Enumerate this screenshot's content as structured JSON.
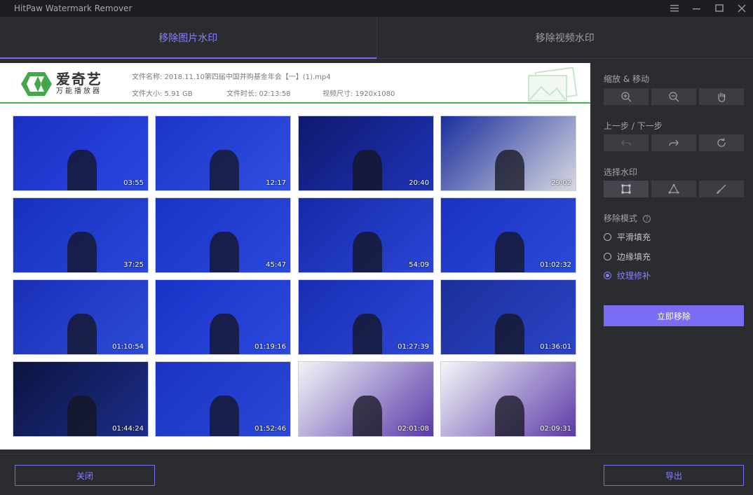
{
  "app": {
    "title": "HitPaw Watermark Remover"
  },
  "window_controls": [
    "menu-icon",
    "minimize-icon",
    "maximize-icon",
    "close-icon"
  ],
  "tabs": [
    {
      "label": "移除图片水印",
      "active": true
    },
    {
      "label": "移除视频水印",
      "active": false
    }
  ],
  "preview": {
    "logo": {
      "main": "爱奇艺",
      "sub": "万能播放器"
    },
    "file_name": "文件名称: 2018.11.10第四届中国并购基金年会【一】(1).mp4",
    "file_size": "文件大小: 5.91 GB",
    "duration": "文件时长: 02:13:58",
    "resolution": "视频尺寸: 1920x1080",
    "thumbnails": [
      {
        "time": "03:55"
      },
      {
        "time": "12:17"
      },
      {
        "time": "20:40"
      },
      {
        "time": "29:02"
      },
      {
        "time": "37:25"
      },
      {
        "time": "45:47"
      },
      {
        "time": "54:09"
      },
      {
        "time": "01:02:32"
      },
      {
        "time": "01:10:54"
      },
      {
        "time": "01:19:16"
      },
      {
        "time": "01:27:39"
      },
      {
        "time": "01:36:01"
      },
      {
        "time": "01:44:24"
      },
      {
        "time": "01:52:46"
      },
      {
        "time": "02:01:08"
      },
      {
        "time": "02:09:31"
      }
    ]
  },
  "sidebar": {
    "zoom_label": "缩放 & 移动",
    "zoom_tools": [
      "zoom-in-icon",
      "zoom-out-icon",
      "hand-icon"
    ],
    "history_label": "上一步 / 下一步",
    "history_tools": [
      "undo-icon",
      "redo-icon",
      "reset-icon"
    ],
    "select_label": "选择水印",
    "select_tools": [
      "rectangle-select-icon",
      "polygon-select-icon",
      "brush-icon"
    ],
    "mode_label": "移除模式",
    "modes": [
      {
        "label": "平滑填充",
        "selected": false
      },
      {
        "label": "边缘填充",
        "selected": false
      },
      {
        "label": "纹理修补",
        "selected": true
      }
    ],
    "remove_button": "立即移除"
  },
  "footer": {
    "close_button": "关闭",
    "export_button": "导出"
  },
  "colors": {
    "accent": "#7b6cf6",
    "background": "#2b2c30",
    "titlebar": "#1c1d20",
    "logo_green": "#4caf50"
  }
}
